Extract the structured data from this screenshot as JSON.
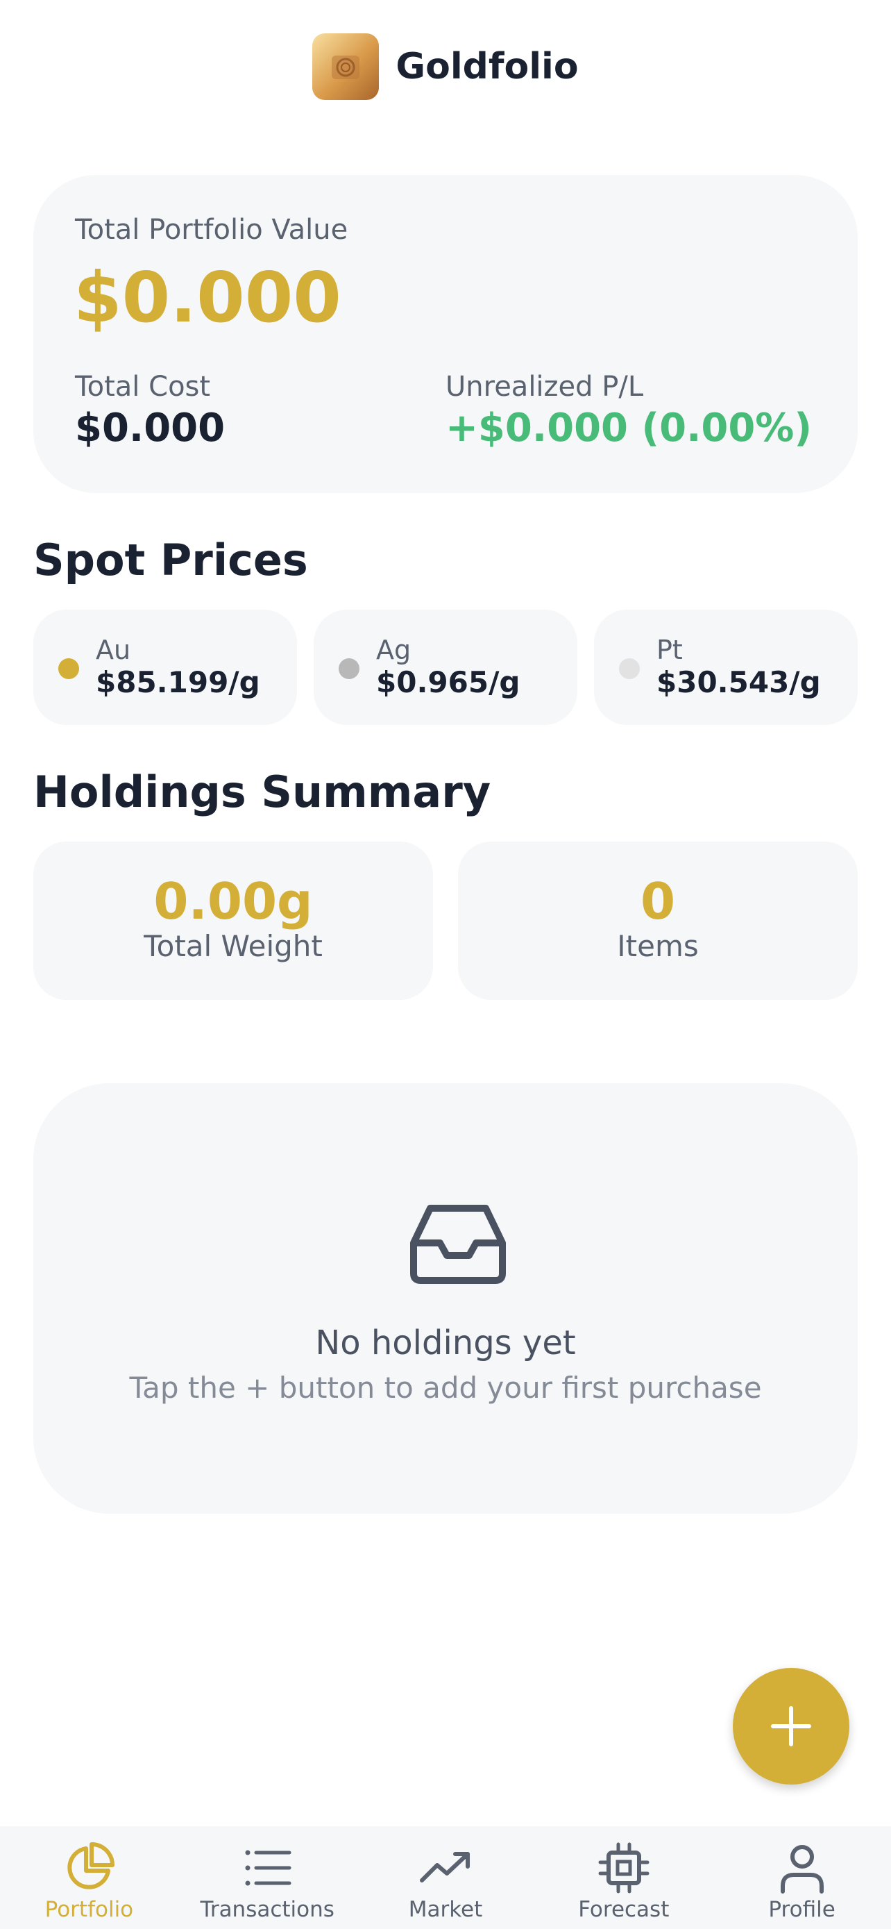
{
  "app": {
    "title": "Goldfolio"
  },
  "portfolio": {
    "total_label": "Total Portfolio Value",
    "total_value": "$0.000",
    "cost_label": "Total Cost",
    "cost_value": "$0.000",
    "pl_label": "Unrealized P/L",
    "pl_value": "+$0.000 (0.00%)"
  },
  "spot": {
    "title": "Spot Prices",
    "items": [
      {
        "symbol": "Au",
        "price": "$85.199/g",
        "color": "#d4af37"
      },
      {
        "symbol": "Ag",
        "price": "$0.965/g",
        "color": "#b8b8b8"
      },
      {
        "symbol": "Pt",
        "price": "$30.543/g",
        "color": "#e2e2e2"
      }
    ]
  },
  "holdings": {
    "title": "Holdings Summary",
    "weight_value": "0.00g",
    "weight_label": "Total Weight",
    "items_value": "0",
    "items_label": "Items"
  },
  "empty": {
    "icon": "inbox-icon",
    "title": "No holdings yet",
    "subtitle": "Tap the + button to add your first purchase"
  },
  "fab": {
    "icon": "plus-icon"
  },
  "tabs": [
    {
      "label": "Portfolio",
      "icon": "pie-chart-icon",
      "active": true
    },
    {
      "label": "Transactions",
      "icon": "list-icon",
      "active": false
    },
    {
      "label": "Market",
      "icon": "trending-up-icon",
      "active": false
    },
    {
      "label": "Forecast",
      "icon": "cpu-icon",
      "active": false
    },
    {
      "label": "Profile",
      "icon": "user-icon",
      "active": false
    }
  ],
  "colors": {
    "accent": "#d4af37",
    "positive": "#48bb78",
    "text": "#1a2232",
    "muted": "#5a6270"
  }
}
